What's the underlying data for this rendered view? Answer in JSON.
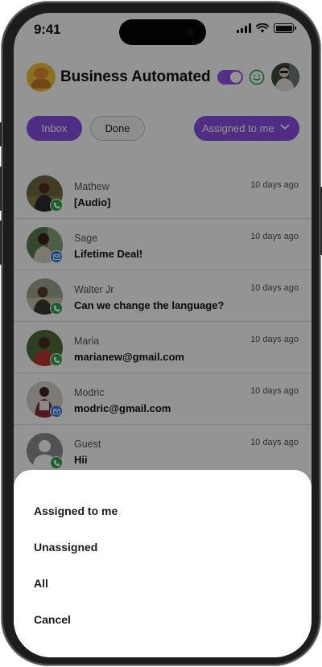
{
  "status_bar": {
    "time": "9:41"
  },
  "header": {
    "title": "Business Automated"
  },
  "filters": {
    "inbox": "Inbox",
    "done": "Done",
    "assigned": "Assigned to me"
  },
  "conversations": [
    {
      "name": "Mathew",
      "message": "[Audio]",
      "time": "10 days ago",
      "channel": "phone-icon"
    },
    {
      "name": "Sage",
      "message": "Lifetime Deal!",
      "time": "10 days ago",
      "channel": "mail-icon"
    },
    {
      "name": "Walter Jr",
      "message": "Can we change the language?",
      "time": "10 days ago",
      "channel": "phone-icon"
    },
    {
      "name": "Maria",
      "message": "marianew@gmail.com",
      "time": "10 days ago",
      "channel": "phone-icon"
    },
    {
      "name": "Modric",
      "message": "modric@gmail.com",
      "time": "10 days ago",
      "channel": "mail-icon"
    },
    {
      "name": "Guest",
      "message": "Hii",
      "time": "10 days ago",
      "channel": "phone-icon"
    }
  ],
  "action_sheet": {
    "options": [
      "Assigned to me",
      "Unassigned",
      "All",
      "Cancel"
    ]
  },
  "colors": {
    "accent": "#8a4ee3",
    "phone_badge": "#27a844",
    "mail_badge": "#2e7be5"
  }
}
